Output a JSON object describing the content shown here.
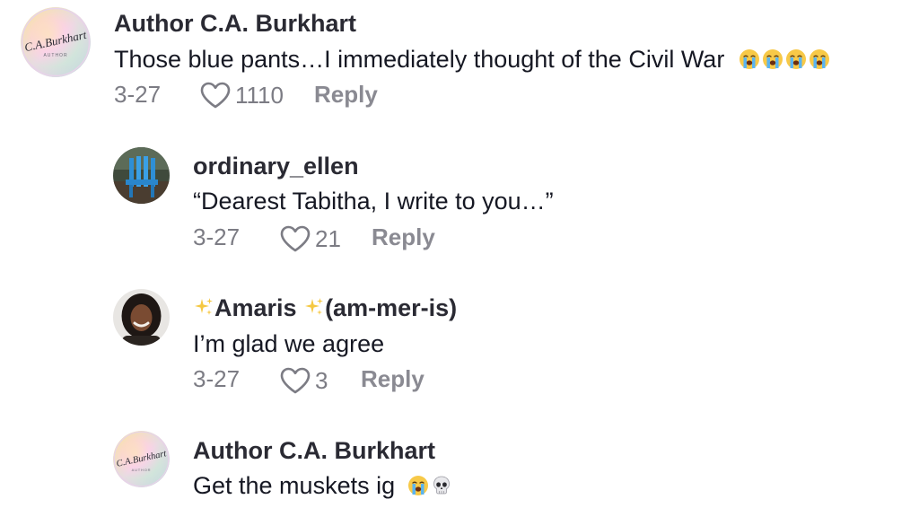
{
  "comments": [
    {
      "username": "Author C.A. Burkhart",
      "text": "Those blue pants…I immediately thought of the Civil War",
      "emojis": [
        "loudly-crying-face",
        "loudly-crying-face",
        "loudly-crying-face",
        "loudly-crying-face"
      ],
      "date": "3-27",
      "likes": "1110",
      "reply_label": "Reply",
      "avatar_text": "C.A.Burkhart",
      "avatar_subtext": "AUTHOR"
    },
    {
      "username": "ordinary_ellen",
      "text": "“Dearest Tabitha, I write to you…”",
      "date": "3-27",
      "likes": "21",
      "reply_label": "Reply"
    },
    {
      "username_prefix_icon": "sparkles",
      "username_main": "Amaris",
      "username_suffix": "(am-mer-is)",
      "text": "I’m glad we agree",
      "date": "3-27",
      "likes": "3",
      "reply_label": "Reply"
    },
    {
      "username": "Author C.A. Burkhart",
      "text": "Get the muskets ig",
      "emojis": [
        "loudly-crying-face",
        "skull"
      ],
      "avatar_text": "C.A.Burkhart",
      "avatar_subtext": "AUTHOR"
    }
  ],
  "colors": {
    "username": "#2a2a33",
    "text": "#161823",
    "meta": "#7c7c84",
    "reply": "#8a8a92"
  }
}
